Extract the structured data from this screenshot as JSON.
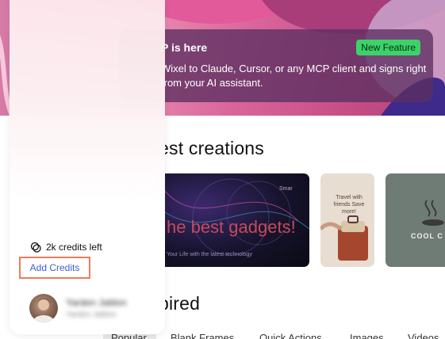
{
  "banner": {
    "title": "P is here",
    "description": "Wixel to Claude, Cursor, or any MCP client and signs right from your AI assistant.",
    "badge": "New Feature"
  },
  "sections": {
    "creations_title": "est creations",
    "inspired_title": "pired"
  },
  "gallery": [
    {
      "name": "gadgets",
      "headline": "he best gadgets!",
      "subline": "Your Life with the latest technology",
      "small": "Smar"
    },
    {
      "name": "travel",
      "headline": "Travel with friends Save more!"
    },
    {
      "name": "cool",
      "headline": "COOL C"
    }
  ],
  "tabs": [
    "Popular",
    "Blank Frames",
    "Quick Actions",
    "Images",
    "Videos"
  ],
  "sidebar": {
    "credits_text": "2k credits left",
    "add_credits_label": "Add Credits",
    "user_name": "Yarden Jablon",
    "user_email": "Yarden Jablon"
  },
  "colors": {
    "badge": "#3cd26a",
    "add_credits_border": "#f07b57",
    "link": "#3b5fd6"
  }
}
